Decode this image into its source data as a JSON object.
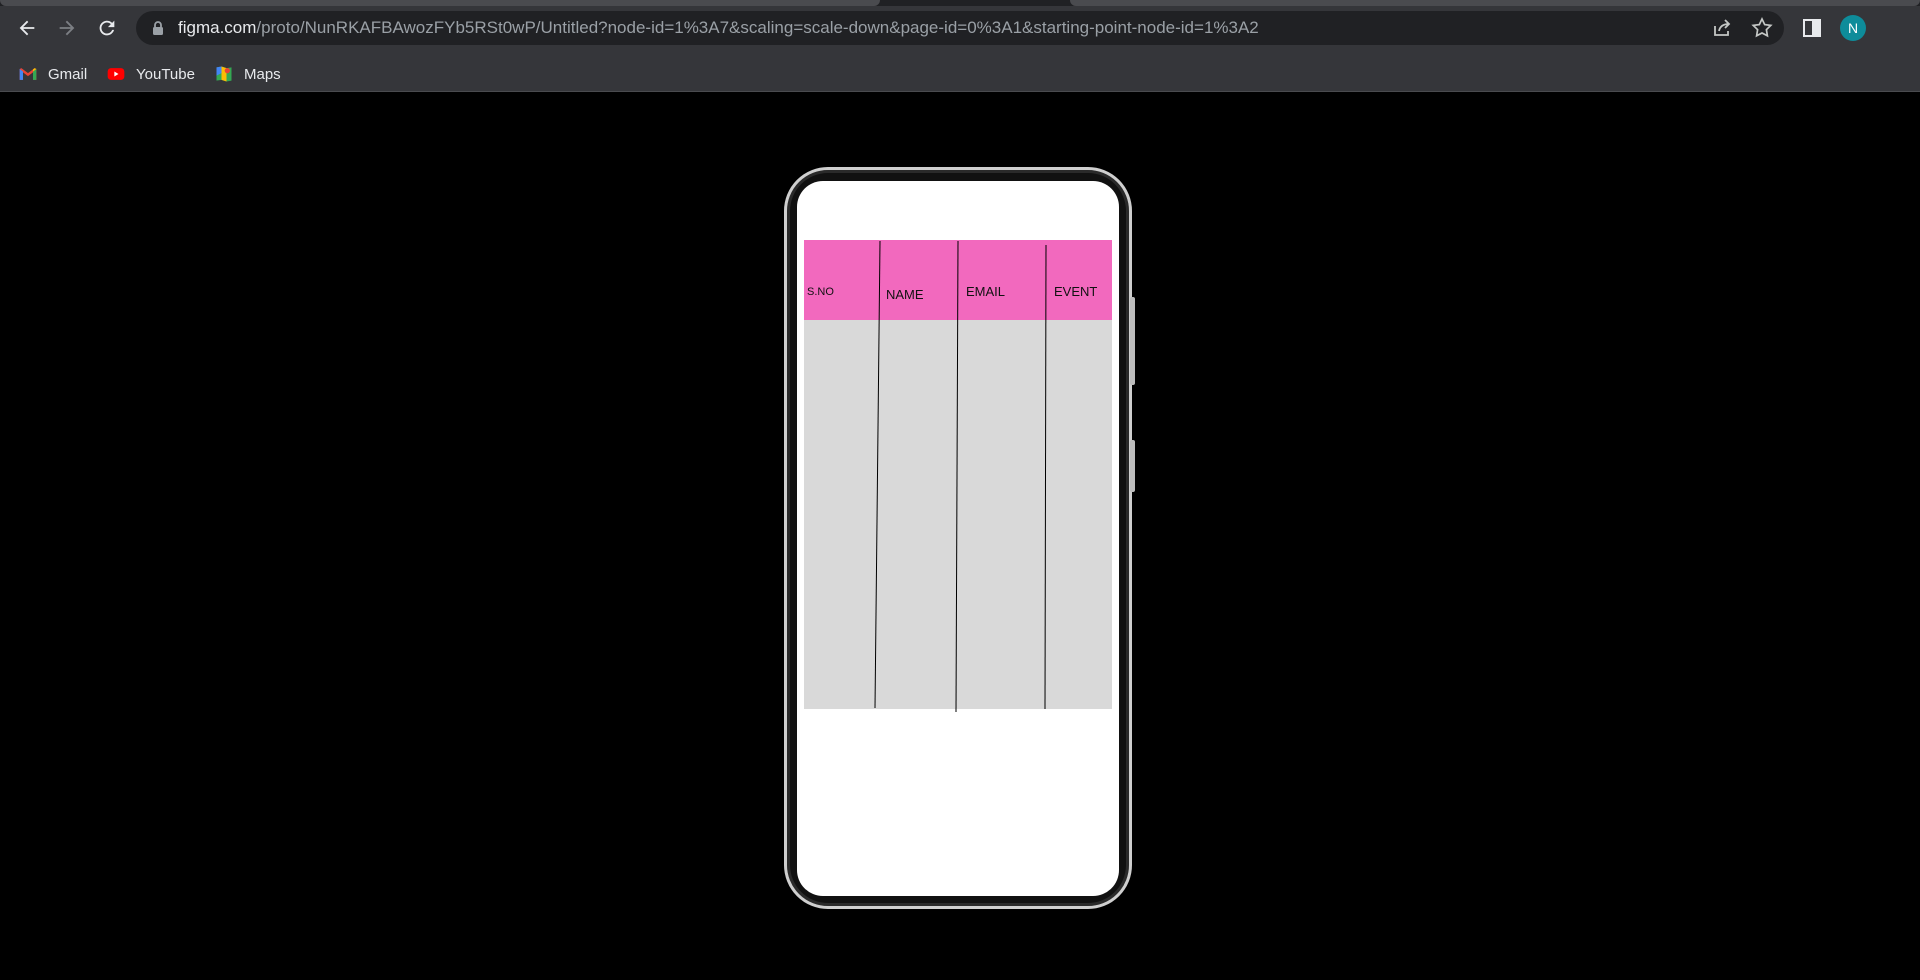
{
  "browser": {
    "url_host": "figma.com",
    "url_path": "/proto/NunRKAFBAwozFYb5RSt0wP/Untitled?node-id=1%3A7&scaling=scale-down&page-id=0%3A1&starting-point-node-id=1%3A2",
    "profile_initial": "N",
    "nav_icons": [
      "back-arrow-icon",
      "forward-arrow-icon",
      "reload-icon"
    ],
    "omnibox_icons": [
      "lock-icon",
      "share-icon",
      "star-icon"
    ],
    "toolbar_icons": [
      "side-panel-icon"
    ]
  },
  "bookmarks": [
    {
      "label": "Gmail",
      "icon": "gmail-icon"
    },
    {
      "label": "YouTube",
      "icon": "youtube-icon"
    },
    {
      "label": "Maps",
      "icon": "maps-icon"
    }
  ],
  "prototype": {
    "table": {
      "columns": [
        "S.NO",
        "NAME",
        "EMAIL",
        "EVENT"
      ],
      "rows": []
    },
    "colors": {
      "header_fill": "#f269be",
      "body_fill": "#d9d9d9",
      "page_background": "#000000",
      "screen_background": "#ffffff"
    }
  }
}
